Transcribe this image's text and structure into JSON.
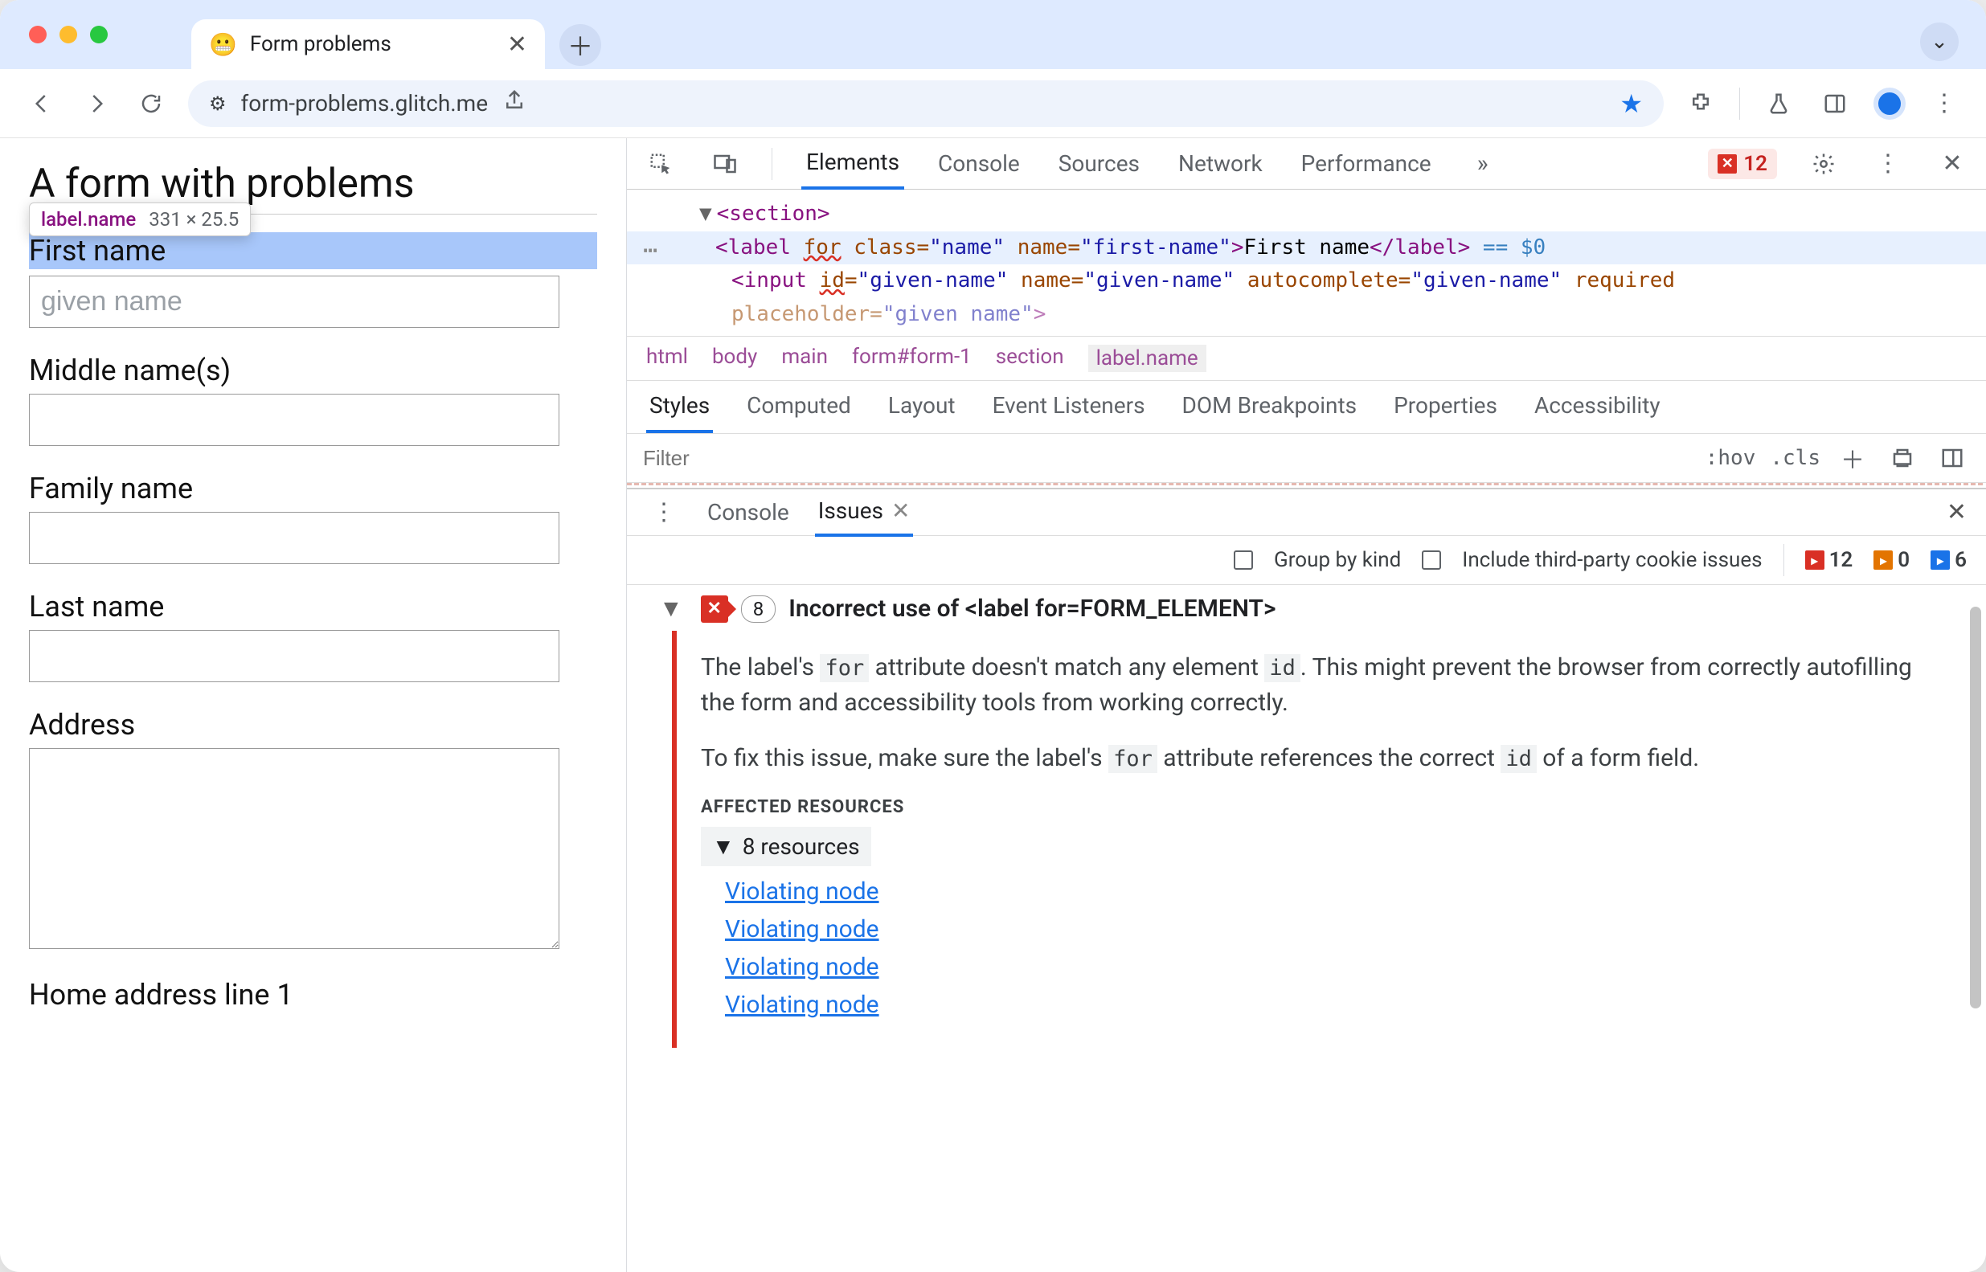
{
  "browser": {
    "tabTitle": "Form problems",
    "tabFavicon": "😬",
    "url": "form-problems.glitch.me"
  },
  "tooltip": {
    "selector": "label.name",
    "dimensions": "331 × 25.5"
  },
  "page": {
    "heading": "A form with problems",
    "fields": {
      "first": {
        "label": "First name",
        "placeholder": "given name"
      },
      "middle": {
        "label": "Middle name(s)"
      },
      "family": {
        "label": "Family name"
      },
      "last": {
        "label": "Last name"
      },
      "address": {
        "label": "Address"
      },
      "home1": {
        "label": "Home address line 1"
      }
    }
  },
  "devtools": {
    "tabs": [
      "Elements",
      "Console",
      "Sources",
      "Network",
      "Performance"
    ],
    "errorCount": "12",
    "dom": {
      "section": "<section>",
      "label_open": "<label",
      "label_for": "for",
      "label_class_attr": "class=",
      "label_class_val": "\"name\"",
      "label_name_attr": "name=",
      "label_name_val": "\"first-name\"",
      "label_close": ">",
      "label_text": "First name",
      "label_end": "</label>",
      "eq0": " == $0",
      "input_open": "<input",
      "input_id": "id",
      "input_id_eq": "=",
      "input_id_val": "\"given-name\"",
      "input_name": "name=",
      "input_name_val": "\"given-name\"",
      "input_ac": "autocomplete=",
      "input_ac_val": "\"given-name\"",
      "input_req": "required",
      "input_ph": "placeholder=",
      "input_ph_val": "\"given name\"",
      "input_end": ">"
    },
    "breadcrumb": [
      "html",
      "body",
      "main",
      "form#form-1",
      "section",
      "label.name"
    ],
    "stylesTabs": [
      "Styles",
      "Computed",
      "Layout",
      "Event Listeners",
      "DOM Breakpoints",
      "Properties",
      "Accessibility"
    ],
    "filterPlaceholder": "Filter",
    "hov": ":hov",
    "cls": ".cls",
    "drawer": {
      "tabs": [
        "Console",
        "Issues"
      ],
      "groupByKind": "Group by kind",
      "thirdParty": "Include third-party cookie issues",
      "counts": {
        "red": "12",
        "orange": "0",
        "blue": "6"
      }
    },
    "issue": {
      "count": "8",
      "title": "Incorrect use of <label for=FORM_ELEMENT>",
      "p1a": "The label's ",
      "p1code1": "for",
      "p1b": " attribute doesn't match any element ",
      "p1code2": "id",
      "p1c": ". This might prevent the browser from correctly autofilling the form and accessibility tools from working correctly.",
      "p2a": "To fix this issue, make sure the label's ",
      "p2code1": "for",
      "p2b": " attribute references the correct ",
      "p2code2": "id",
      "p2c": " of a form field.",
      "affected": "AFFECTED RESOURCES",
      "resToggle": "8 resources",
      "violating": [
        "Violating node",
        "Violating node",
        "Violating node",
        "Violating node"
      ]
    }
  }
}
